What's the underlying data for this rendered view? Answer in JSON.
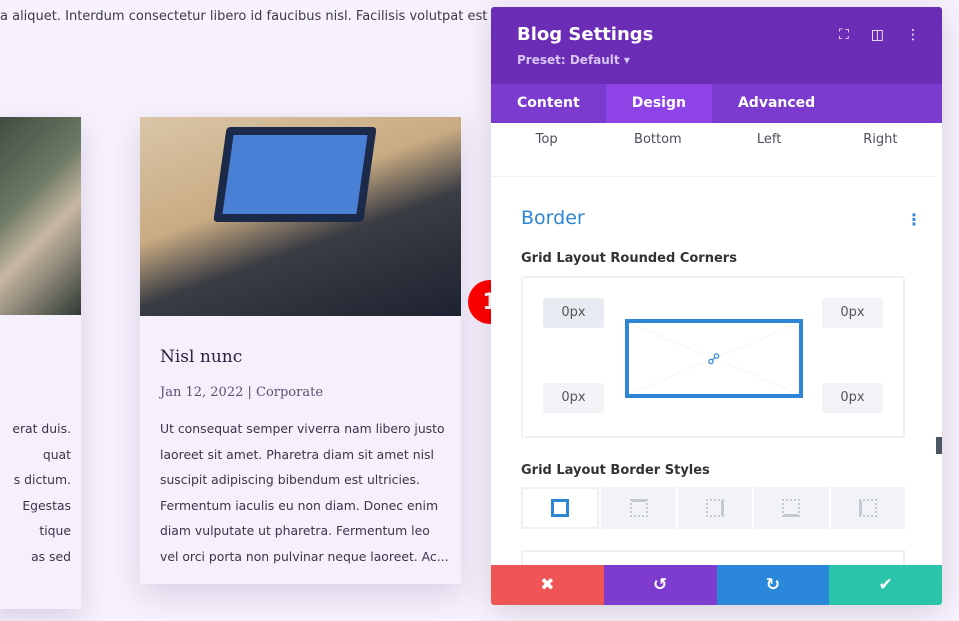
{
  "intro_text": "a aliquet. Interdum consectetur libero id faucibus nisl. Facilisis volutpat est",
  "cards": [
    {
      "partial_lines": [
        "erat duis.",
        "quat",
        "s dictum.",
        "Egestas",
        "tique",
        "as sed"
      ]
    },
    {
      "title": "Nisl nunc",
      "meta": "Jan 12, 2022 | Corporate",
      "excerpt": "Ut consequat semper viverra nam libero justo laoreet sit amet. Pharetra diam sit amet nisl suscipit adipiscing bibendum est ultricies. Fermentum iaculis eu non diam. Donec enim diam vulputate ut pharetra. Fermentum leo vel orci porta non pulvinar neque laoreet. Ac..."
    }
  ],
  "badge": "1",
  "panel": {
    "title": "Blog Settings",
    "preset": "Preset: Default ▾",
    "tabs": [
      "Content",
      "Design",
      "Advanced"
    ],
    "active_tab": "Design",
    "sides": [
      "Top",
      "Bottom",
      "Left",
      "Right"
    ],
    "section": "Border",
    "rounded_label": "Grid Layout Rounded Corners",
    "corners": {
      "top_left": "0px",
      "top_right": "0px",
      "bottom_left": "0px",
      "bottom_right": "0px"
    },
    "styles_label": "Grid Layout Border Styles",
    "colors": {
      "header": "#6b2db5",
      "tabs": "#7b3bcf",
      "active_tab": "#8e43e7",
      "accent": "#2e86d6",
      "cancel": "#ef5555",
      "undo": "#7e3bd0",
      "redo": "#2b87da",
      "save": "#29c4a9"
    }
  }
}
